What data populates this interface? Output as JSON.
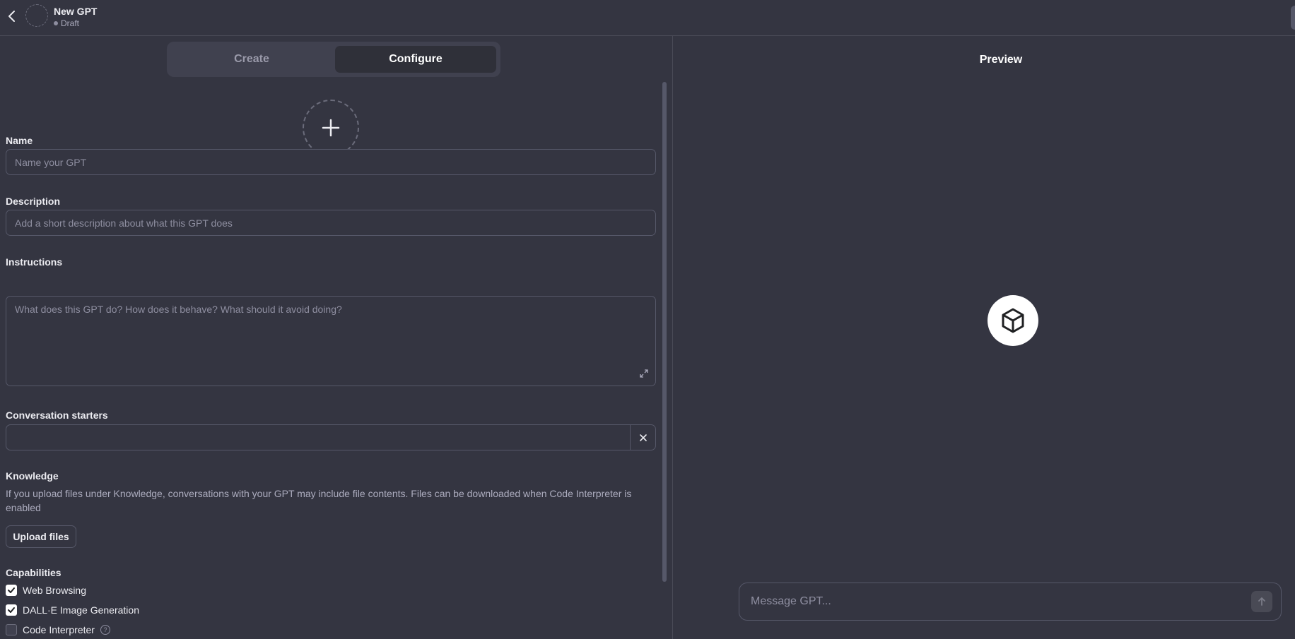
{
  "header": {
    "title": "New GPT",
    "status": "Draft"
  },
  "tabs": [
    {
      "label": "Create",
      "active": false
    },
    {
      "label": "Configure",
      "active": true
    }
  ],
  "form": {
    "name": {
      "label": "Name",
      "placeholder": "Name your GPT",
      "value": ""
    },
    "description": {
      "label": "Description",
      "placeholder": "Add a short description about what this GPT does",
      "value": ""
    },
    "instructions": {
      "label": "Instructions",
      "placeholder": "What does this GPT do? How does it behave? What should it avoid doing?",
      "value": ""
    },
    "conversation_starters": {
      "label": "Conversation starters",
      "value": ""
    },
    "knowledge": {
      "label": "Knowledge",
      "description": "If you upload files under Knowledge, conversations with your GPT may include file contents. Files can be downloaded when Code Interpreter is enabled",
      "upload_label": "Upload files"
    },
    "capabilities": {
      "label": "Capabilities",
      "items": [
        {
          "label": "Web Browsing",
          "checked": true
        },
        {
          "label": "DALL·E Image Generation",
          "checked": true
        },
        {
          "label": "Code Interpreter",
          "checked": false,
          "help": "?"
        }
      ]
    }
  },
  "preview": {
    "title": "Preview",
    "message_placeholder": "Message GPT..."
  },
  "icons": {
    "back": "chevron-left-icon",
    "add": "plus-icon",
    "expand": "expand-icon",
    "remove": "close-icon",
    "logo": "cube-icon",
    "send": "arrow-up-icon"
  },
  "colors": {
    "background": "#343541",
    "border": "#565869",
    "text": "#ececf1",
    "muted": "#8e8ea0"
  }
}
